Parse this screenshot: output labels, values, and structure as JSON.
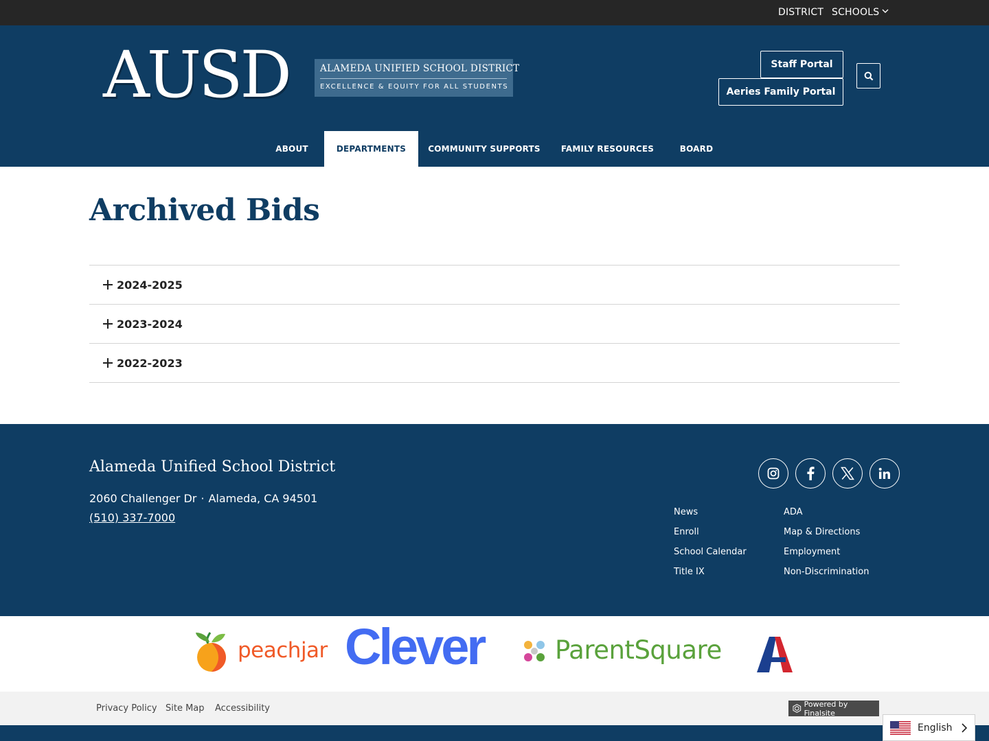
{
  "utility": {
    "district": "DISTRICT",
    "schools": "SCHOOLS"
  },
  "logo": {
    "letters": "AUSD",
    "title": "ALAMEDA UNIFIED SCHOOL DISTRICT",
    "tagline": "EXCELLENCE & EQUITY FOR ALL STUDENTS"
  },
  "header": {
    "staff_portal": "Staff Portal",
    "family_portal": "Aeries Family Portal"
  },
  "nav": {
    "about": "ABOUT",
    "departments": "DEPARTMENTS",
    "community": "COMMUNITY SUPPORTS",
    "family": "FAMILY RESOURCES",
    "board": "BOARD",
    "active": "DEPARTMENTS"
  },
  "main": {
    "title": "Archived Bids",
    "accordion": [
      "2024-2025",
      "2023-2024",
      "2022-2023"
    ]
  },
  "footer": {
    "name": "Alameda Unified School District",
    "street": "2060 Challenger Dr",
    "separator": "·",
    "city": "Alameda, CA  94501",
    "phone": "(510) 337-7000",
    "links_col1": [
      "News",
      "Enroll",
      "School Calendar",
      "Title IX"
    ],
    "links_col2": [
      "ADA",
      "Map & Directions",
      "Employment",
      "Non-Discrimination"
    ]
  },
  "partners": {
    "peachjar": "peachjar",
    "clever": "Clever",
    "parentsquare": "ParentSquare"
  },
  "bottom": {
    "privacy": "Privacy Policy",
    "sitemap": "Site Map",
    "accessibility": "Accessibility",
    "finalsite": "Powered by Finalsite"
  },
  "language": {
    "label": "English"
  },
  "colors": {
    "primary": "#0f3d63",
    "utility_bar": "#262626",
    "clever_blue": "#436cf2",
    "peachjar_orange": "#f05a28",
    "parentsquare_green": "#5aa23c"
  },
  "icons": [
    "chevron-down-icon",
    "search-icon",
    "plus-icon",
    "instagram-icon",
    "facebook-icon",
    "x-icon",
    "linkedin-icon",
    "us-flag-icon",
    "chevron-right-icon",
    "finalsite-icon"
  ]
}
